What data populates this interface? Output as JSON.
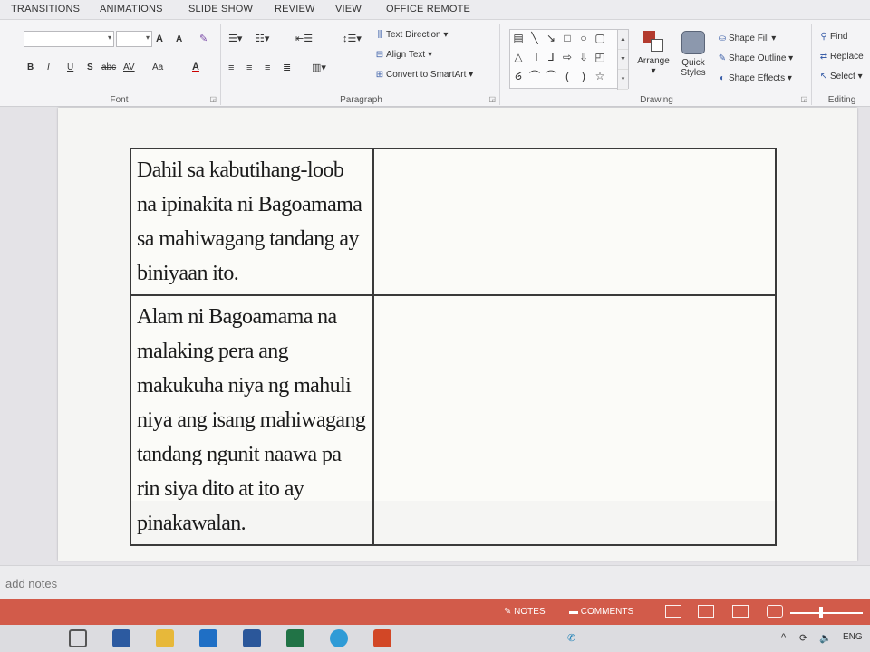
{
  "ribbon_tabs": [
    "TRANSITIONS",
    "ANIMATIONS",
    "SLIDE SHOW",
    "REVIEW",
    "VIEW",
    "OFFICE REMOTE"
  ],
  "groups": {
    "font": {
      "label": "Font",
      "bold": "B",
      "italic": "I",
      "underline": "U",
      "shadow": "S",
      "strike": "abc",
      "spacing": "AV",
      "case": "Aa",
      "font_color": "A",
      "grow": "A",
      "shrink": "A"
    },
    "paragraph": {
      "label": "Paragraph",
      "text_direction": "Text Direction",
      "align_text": "Align Text",
      "convert_smartart": "Convert to SmartArt"
    },
    "drawing": {
      "label": "Drawing",
      "arrange": "Arrange",
      "quick_styles": "Quick Styles",
      "shape_fill": "Shape Fill",
      "shape_outline": "Shape Outline",
      "shape_effects": "Shape Effects"
    },
    "editing": {
      "label": "Editing",
      "find": "Find",
      "replace": "Replace",
      "select": "Select"
    }
  },
  "table": {
    "rows": [
      {
        "left": "Dahil sa kabutihang-loob na ipinakita ni Bagoamama sa mahiwagang tandang ay biniyaan ito.",
        "right": ""
      },
      {
        "left": "Alam ni Bagoamama na malaking pera ang makukuha niya ng mahuli niya ang isang mahiwagang tandang ngunit naawa pa rin siya dito at ito ay pinakawalan.",
        "right": ""
      }
    ]
  },
  "notes_placeholder": "add notes",
  "status": {
    "notes": "NOTES",
    "comments": "COMMENTS"
  },
  "tray": {
    "lang": "ENG"
  },
  "colors": {
    "status_bar": "#d25b4a",
    "accent_blue": "#3a5ea8"
  }
}
